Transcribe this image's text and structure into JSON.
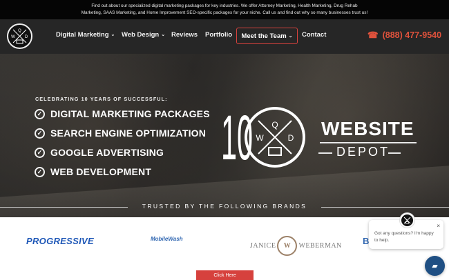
{
  "topbar": {
    "line1": "Find out about our specialized digital marketing packages for key industries. We offer Attorney Marketing, Health Marketing, Drug Rehab",
    "line2": "Marketing, SAAS Marketing, and Home Improvement SEO-specific packages for your niche. Call us and find out why so many businesses trust us!"
  },
  "nav": {
    "items": [
      "Digital Marketing",
      "Web Design",
      "Reviews",
      "Portfolio",
      "Meet the Team",
      "Contact"
    ],
    "phone": "(888) 477-9540",
    "accent": "#d6413d"
  },
  "logo": {
    "letters": [
      "Q",
      "W",
      "D"
    ]
  },
  "hero": {
    "kicker": "CELEBRATING 10 YEARS OF SUCCESSFUL:",
    "services": [
      "DIGITAL MARKETING PACKAGES",
      "SEARCH ENGINE OPTIMIZATION",
      "GOOGLE ADVERTISING",
      "WEB DEVELOPMENT"
    ],
    "brand_number": "10",
    "brand_top": "WEBSITE",
    "brand_bottom": "DEPOT",
    "trusted": "TRUSTED BY THE FOLLOWING BRANDS"
  },
  "brands": [
    "PROGRESSIVE",
    "MobileWash",
    "JANICE",
    "W",
    "WEBERMAN",
    "B"
  ],
  "chat": {
    "message": "Got any questions? I'm happy to help."
  },
  "cta": {
    "label": "Click Here"
  }
}
